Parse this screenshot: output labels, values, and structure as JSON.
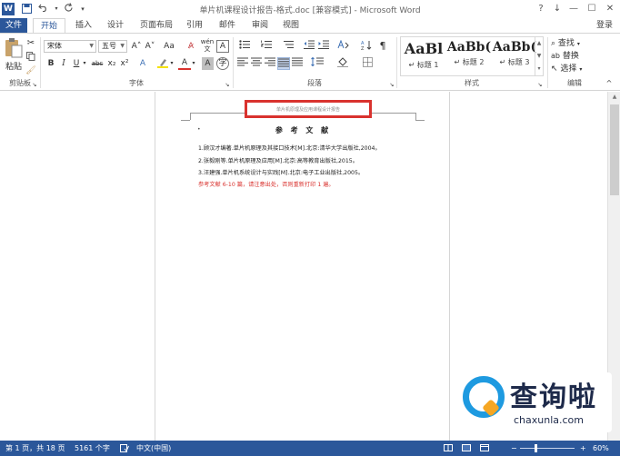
{
  "window": {
    "title": "单片机课程设计报告-格式.doc [兼容模式] - Microsoft Word",
    "app_icon": "W",
    "quick_access": [
      "save-icon",
      "undo-icon",
      "redo-icon"
    ],
    "controls": [
      "?",
      "↓",
      "—",
      "☐",
      "✕"
    ]
  },
  "tabs": [
    {
      "label": "文件"
    },
    {
      "label": "开始"
    },
    {
      "label": "插入"
    },
    {
      "label": "设计"
    },
    {
      "label": "页面布局"
    },
    {
      "label": "引用"
    },
    {
      "label": "邮件"
    },
    {
      "label": "审阅"
    },
    {
      "label": "视图"
    }
  ],
  "login": "登录",
  "ribbon": {
    "clipboard": {
      "paste": "粘贴",
      "label": "剪贴板"
    },
    "font": {
      "name": "宋体",
      "size": "五号",
      "label": "字体",
      "grow": "A˄",
      "shrink": "A˅",
      "case": "Aa",
      "bold": "B",
      "italic": "I",
      "underline": "U",
      "strike": "abc",
      "sub": "x₂",
      "sup": "x²",
      "font_color": "A"
    },
    "paragraph": {
      "label": "段落"
    },
    "styles": {
      "label": "样式",
      "items": [
        {
          "sample": "AaBl",
          "name": "↵ 标题 1"
        },
        {
          "sample": "AaBb(",
          "name": "↵ 标题 2"
        },
        {
          "sample": "AaBb(",
          "name": "↵ 标题 3"
        }
      ]
    },
    "editing": {
      "label": "编辑",
      "find": "查找",
      "replace": "替换",
      "select": "选择"
    }
  },
  "document": {
    "header_text": "单片机原理及应用课程设计报告",
    "ref_title": "参 考 文 献",
    "references": [
      "1.顾汉才编著.单片机原理及其接口技术[M].北京:清华大学出版社,2004。",
      "2.张毅刚等.单片机原理及应用[M].北京:高等教育出版社,2015。",
      "3.汪建强.单片机系统设计与实践[M].北京:电子工业出版社,2005。"
    ],
    "note": "参考文献 6-10 篇，请注意出处，否则重新打印 1 遍。"
  },
  "status": {
    "page": "第 1 页，共 18 页",
    "words": "5161 个字",
    "lang": "中文(中国)",
    "zoom": "60%",
    "zoom_fraction": 0.6
  },
  "watermark": {
    "cn": "查询啦",
    "en": "chaxunla.com"
  },
  "colors": {
    "accent": "#2b579a",
    "highlight_box": "#d9322e"
  }
}
